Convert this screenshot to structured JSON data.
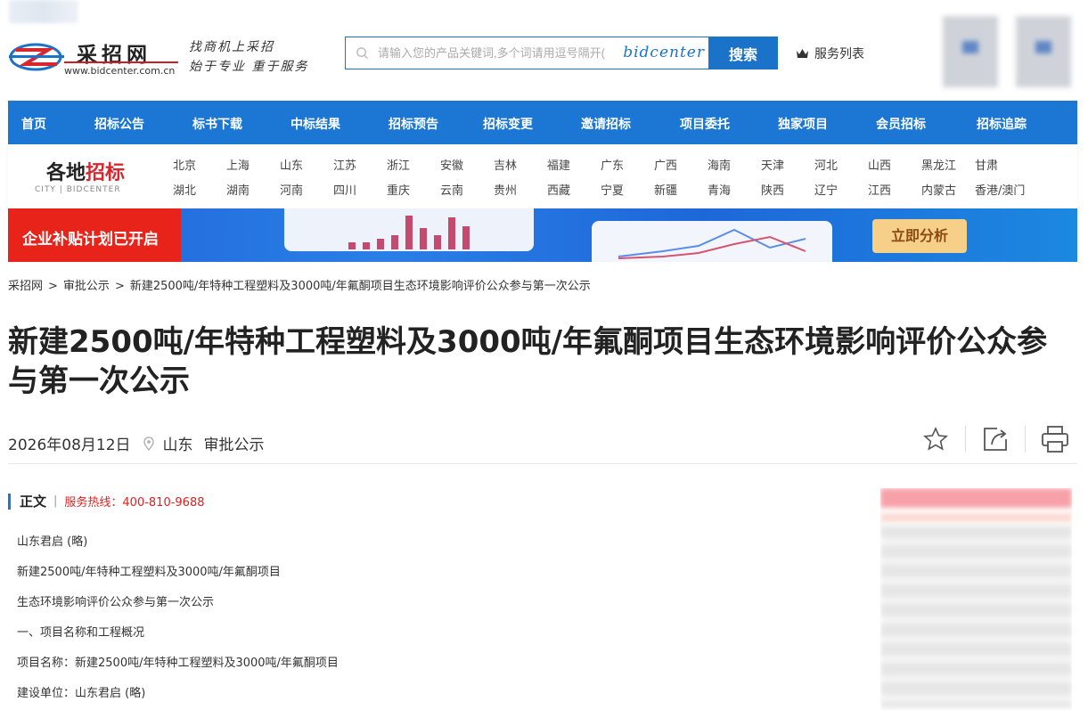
{
  "header": {
    "logo_name": "采招网",
    "logo_url": "www.bidcenter.com.cn",
    "slogan_line1": "找商机上采招",
    "slogan_line2": "始于专业 重于服务",
    "search_placeholder": "请输入您的产品关键词,多个词请用逗号隔开(",
    "search_brand": "bidcenter",
    "search_button": "搜索",
    "service_list": "服务列表"
  },
  "nav": {
    "items": [
      "首页",
      "招标公告",
      "标书下载",
      "中标结果",
      "招标预告",
      "招标变更",
      "邀请招标",
      "项目委托",
      "独家项目",
      "会员招标",
      "招标追踪"
    ]
  },
  "cities": {
    "title_black": "各地",
    "title_red": "招标",
    "subtitle": "CITY | BIDCENTER",
    "row1": [
      "北京",
      "上海",
      "山东",
      "江苏",
      "浙江",
      "安徽",
      "吉林",
      "福建",
      "广东",
      "广西",
      "海南",
      "天津",
      "河北",
      "山西",
      "黑龙江",
      "甘肃"
    ],
    "row2": [
      "湖北",
      "湖南",
      "河南",
      "四川",
      "重庆",
      "云南",
      "贵州",
      "西藏",
      "宁夏",
      "新疆",
      "青海",
      "陕西",
      "辽宁",
      "江西",
      "内蒙古",
      "香港/澳门"
    ]
  },
  "banner": {
    "left_text": "企业补贴计划已开启",
    "button": "立即分析",
    "colors": {
      "red": "#e7231a",
      "blue": "#1f63d8",
      "gold": "#f6d089"
    }
  },
  "breadcrumb": [
    "采招网",
    "审批公示",
    "新建2500吨/年特种工程塑料及3000吨/年氟酮项目生态环境影响评价公众参与第一次公示"
  ],
  "article": {
    "title": "新建2500吨/年特种工程塑料及3000吨/年氟酮项目生态环境影响评价公众参与第一次公示",
    "date": "2026年08月12日",
    "region": "山东",
    "category": "审批公示",
    "section_label": "正文",
    "hotline": "服务热线：400-810-9688",
    "paragraphs": [
      "山东君启 (略)",
      "新建2500吨/年特种工程塑料及3000吨/年氟酮项目",
      "生态环境影响评价公众参与第一次公示",
      "一、项目名称和工程概况",
      "项目名称：新建2500吨/年特种工程塑料及3000吨/年氟酮项目",
      "建设单位：山东君启 (略)"
    ]
  },
  "icons": [
    "search-icon",
    "crown-icon",
    "location-icon",
    "star-icon",
    "share-icon",
    "print-icon"
  ],
  "accent": "#1c77d4"
}
